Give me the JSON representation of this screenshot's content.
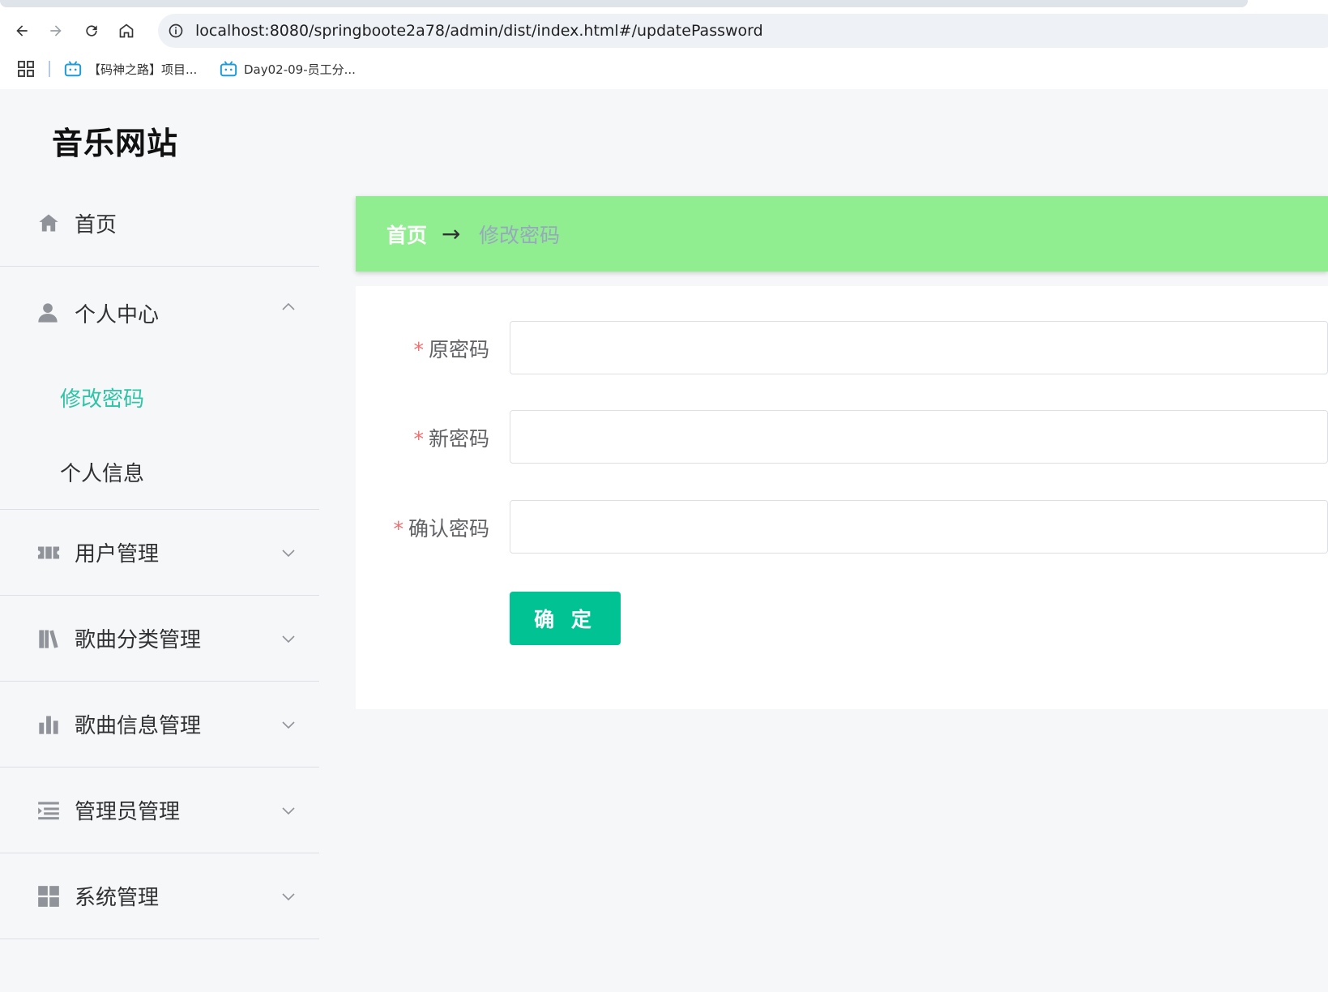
{
  "browser": {
    "url": "localhost:8080/springboote2a78/admin/dist/index.html#/updatePassword",
    "bookmarks": [
      {
        "label": "【码神之路】项目..."
      },
      {
        "label": "Day02-09-员工分..."
      }
    ]
  },
  "app": {
    "title": "音乐网站"
  },
  "sidebar": {
    "home": {
      "label": "首页"
    },
    "personal_center": {
      "label": "个人中心",
      "children": [
        {
          "label": "修改密码",
          "active": true
        },
        {
          "label": "个人信息"
        }
      ]
    },
    "items": [
      {
        "label": "用户管理",
        "icon": "ticket-icon"
      },
      {
        "label": "歌曲分类管理",
        "icon": "books-icon"
      },
      {
        "label": "歌曲信息管理",
        "icon": "bar-chart-icon"
      },
      {
        "label": "管理员管理",
        "icon": "list-indent-icon"
      },
      {
        "label": "系统管理",
        "icon": "grid-icon"
      }
    ]
  },
  "breadcrumb": {
    "home": "首页",
    "separator": "→",
    "current": "修改密码"
  },
  "form": {
    "required_mark": "*",
    "fields": [
      {
        "label": "原密码",
        "value": ""
      },
      {
        "label": "新密码",
        "value": ""
      },
      {
        "label": "确认密码",
        "value": ""
      }
    ],
    "submit_label": "确 定"
  },
  "colors": {
    "accent": "#2ec4a5",
    "breadcrumb_bg": "#90ee90",
    "button_bg": "#00c292",
    "required": "#f56c6c"
  }
}
